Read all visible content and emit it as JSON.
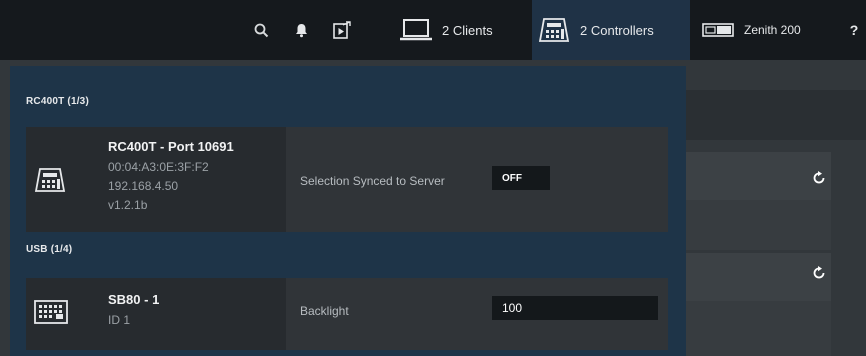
{
  "topbar": {
    "clients_label": "2 Clients",
    "controllers_label": "2 Controllers",
    "device_label": "Zenith 200",
    "help_label": "?"
  },
  "sections": [
    {
      "label": "RC400T (1/3)",
      "device": {
        "name": "RC400T - Port 10691",
        "mac": "00:04:A3:0E:3F:F2",
        "ip": "192.168.4.50",
        "version": "v1.2.1b"
      },
      "property": {
        "label": "Selection Synced to Server",
        "value": "OFF"
      }
    },
    {
      "label": "USB (1/4)",
      "device": {
        "name": "SB80 - 1",
        "id": "ID 1"
      },
      "property": {
        "label": "Backlight",
        "value": "100"
      }
    }
  ],
  "icons": {
    "search": "search-icon",
    "bell": "bell-icon",
    "media": "media-file-icon",
    "clients": "laptop-icon",
    "controllers": "controller-icon",
    "device": "console-device-icon",
    "reset": "reset-icon"
  },
  "colors": {
    "topbar": "#15191d",
    "panel": "#1e3448",
    "active_tab": "#1f3246"
  }
}
